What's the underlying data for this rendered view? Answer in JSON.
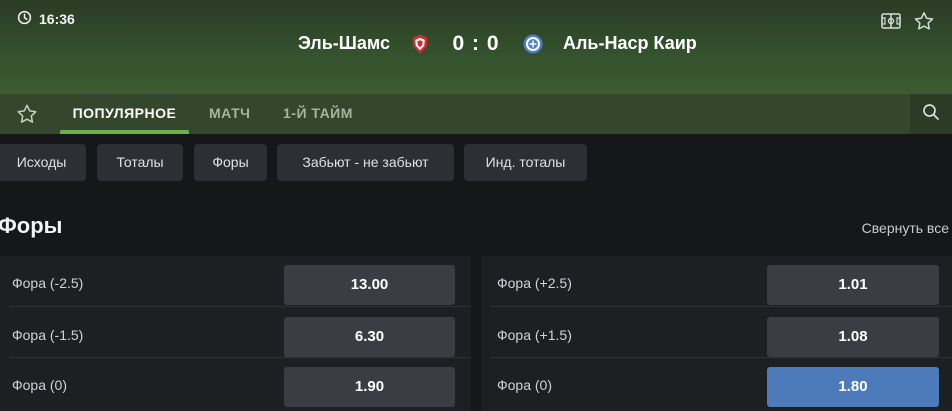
{
  "header": {
    "time": "16:36",
    "home_team": "Эль-Шамс",
    "away_team": "Аль-Наср Каир",
    "score": "0 : 0"
  },
  "tabs": [
    "ПОПУЛЯРНОЕ",
    "МАТЧ",
    "1-Й ТАЙМ"
  ],
  "chips": [
    "Исходы",
    "Тоталы",
    "Форы",
    "Забьют - не забьют",
    "Инд. тоталы"
  ],
  "section": {
    "title": "Форы",
    "collapse_label": "Свернуть все"
  },
  "markets": {
    "left": [
      {
        "label": "Фора (-2.5)",
        "odds": "13.00"
      },
      {
        "label": "Фора (-1.5)",
        "odds": "6.30"
      },
      {
        "label": "Фора (0)",
        "odds": "1.90"
      }
    ],
    "right": [
      {
        "label": "Фора (+2.5)",
        "odds": "1.01"
      },
      {
        "label": "Фора (+1.5)",
        "odds": "1.08"
      },
      {
        "label": "Фора (0)",
        "odds": "1.80"
      }
    ]
  },
  "colors": {
    "accent_green": "#6ab04c",
    "selected_odds": "#4d7bb9",
    "header_green": "#3b5c33"
  },
  "icons": [
    "clock-icon",
    "field-icon",
    "star-icon",
    "search-icon",
    "home-team-logo",
    "away-team-logo"
  ]
}
